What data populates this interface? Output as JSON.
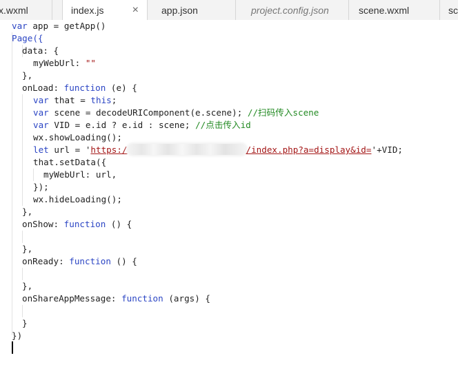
{
  "tabs": [
    {
      "label": "x.wxml",
      "active": false,
      "italic": false
    },
    {
      "label": "index.js",
      "active": true,
      "italic": false
    },
    {
      "label": "app.json",
      "active": false,
      "italic": false
    },
    {
      "label": "project.config.json",
      "active": false,
      "italic": true
    },
    {
      "label": "scene.wxml",
      "active": false,
      "italic": false
    },
    {
      "label": "sc",
      "active": false,
      "italic": false
    }
  ],
  "close_glyph": "×",
  "colors": {
    "keyword": "#2b45c4",
    "string": "#a31515",
    "comment": "#238a23",
    "text": "#1f1f1f"
  },
  "code": {
    "l1": {
      "a": "var",
      "b": " app = getApp()"
    },
    "l2": {
      "a": "Page({"
    },
    "l3": {
      "a": "data: {"
    },
    "l4": {
      "a": "myWebUrl: ",
      "b": "\"\""
    },
    "l5": {
      "a": "},"
    },
    "l6": {
      "a": "onLoad: ",
      "b": "function",
      "c": " (e) {"
    },
    "l7": {
      "a": "var",
      "b": " that = ",
      "c": "this",
      "d": ";"
    },
    "l8": {
      "a": "var",
      "b": " scene = decodeURIComponent(e.scene); ",
      "c": "//扫码传入scene"
    },
    "l9": {
      "a": "var",
      "b": " VID = e.id ? e.id : scene; ",
      "c": "//点击传入id"
    },
    "l10": {
      "a": "wx.showLoading();"
    },
    "l11": {
      "a": "let",
      "b": " url = '",
      "c": "https:/",
      "d": "/index.php?a=display&id=",
      "e": "'+VID;"
    },
    "l12": {
      "a": "that.setData({"
    },
    "l13": {
      "a": "myWebUrl: url,"
    },
    "l14": {
      "a": "});"
    },
    "l15": {
      "a": "wx.hideLoading();"
    },
    "l16": {
      "a": "},"
    },
    "l17": {
      "a": "onShow: ",
      "b": "function",
      "c": " () {"
    },
    "l19": {
      "a": "},"
    },
    "l20": {
      "a": "onReady: ",
      "b": "function",
      "c": " () {"
    },
    "l22": {
      "a": "},"
    },
    "l23": {
      "a": "onShareAppMessage: ",
      "b": "function",
      "c": " (args) {"
    },
    "l25": {
      "a": "}"
    },
    "l26": {
      "a": "})"
    }
  }
}
